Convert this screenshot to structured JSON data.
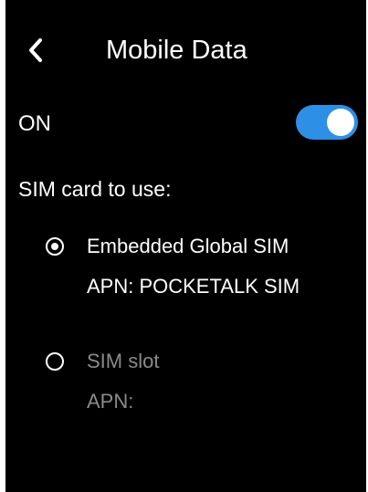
{
  "header": {
    "title": "Mobile Data",
    "back_icon": "chevron-left-icon"
  },
  "mobile_data": {
    "label": "ON",
    "toggle_state": "on",
    "toggle_color": "#2e8fe6"
  },
  "sim": {
    "section_label": "SIM card to use:",
    "options": [
      {
        "name": "Embedded Global SIM",
        "apn": "APN: POCKETALK SIM",
        "selected": true
      },
      {
        "name": "SIM slot",
        "apn": "APN:",
        "selected": false
      }
    ]
  },
  "colors": {
    "background": "#000000",
    "text": "#ffffff",
    "muted_text": "#8a8a8a",
    "accent": "#2e8fe6"
  }
}
